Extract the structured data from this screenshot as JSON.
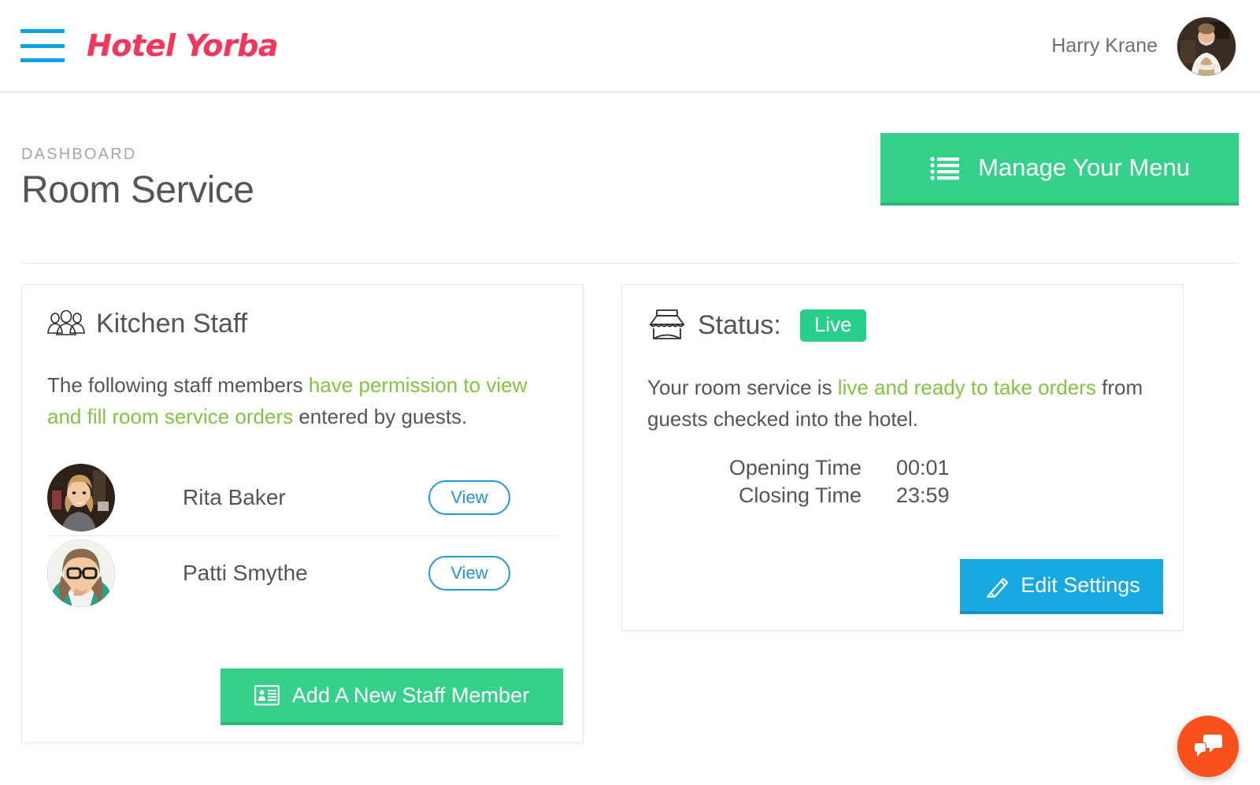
{
  "header": {
    "menu_icon": "hamburger-icon",
    "brand": "Hotel Yorba",
    "user_name": "Harry Krane",
    "avatar_alt": "harry-krane-avatar"
  },
  "page": {
    "breadcrumb": "DASHBOARD",
    "title": "Room Service",
    "primary_action": {
      "label": "Manage Your Menu",
      "icon": "list-icon"
    }
  },
  "staff_card": {
    "icon": "group-people-icon",
    "title": "Kitchen Staff",
    "text_part1": "The following staff members ",
    "text_highlight": "have permission to view and fill room service orders",
    "text_part2": " entered by guests.",
    "members": [
      {
        "name": "Rita Baker",
        "action_label": "View"
      },
      {
        "name": "Patti Smythe",
        "action_label": "View"
      }
    ],
    "add_button": {
      "label": "Add A New Staff Member",
      "icon": "contact-card-icon"
    }
  },
  "status_card": {
    "icon": "storefront-icon",
    "title": "Status:",
    "badge": "Live",
    "text_part1": "Your room service is ",
    "text_highlight": "live and ready to take orders",
    "text_part2": " from guests checked into the hotel.",
    "times": [
      {
        "label": "Opening Time",
        "value": "00:01"
      },
      {
        "label": "Closing Time",
        "value": "23:59"
      }
    ],
    "edit_button": {
      "label": "Edit Settings",
      "icon": "pencil-icon"
    }
  },
  "chat_widget": {
    "icon": "chat-bubbles-icon",
    "color": "#f9511d"
  },
  "colors": {
    "brand": "#f5365c",
    "green": "#35d18b",
    "green_badge": "#27cf8b",
    "blue": "#18a9e0",
    "link_blue": "#1e9bd7",
    "highlight_green": "#84c341",
    "text": "#555555",
    "muted": "#a6a6a6"
  }
}
